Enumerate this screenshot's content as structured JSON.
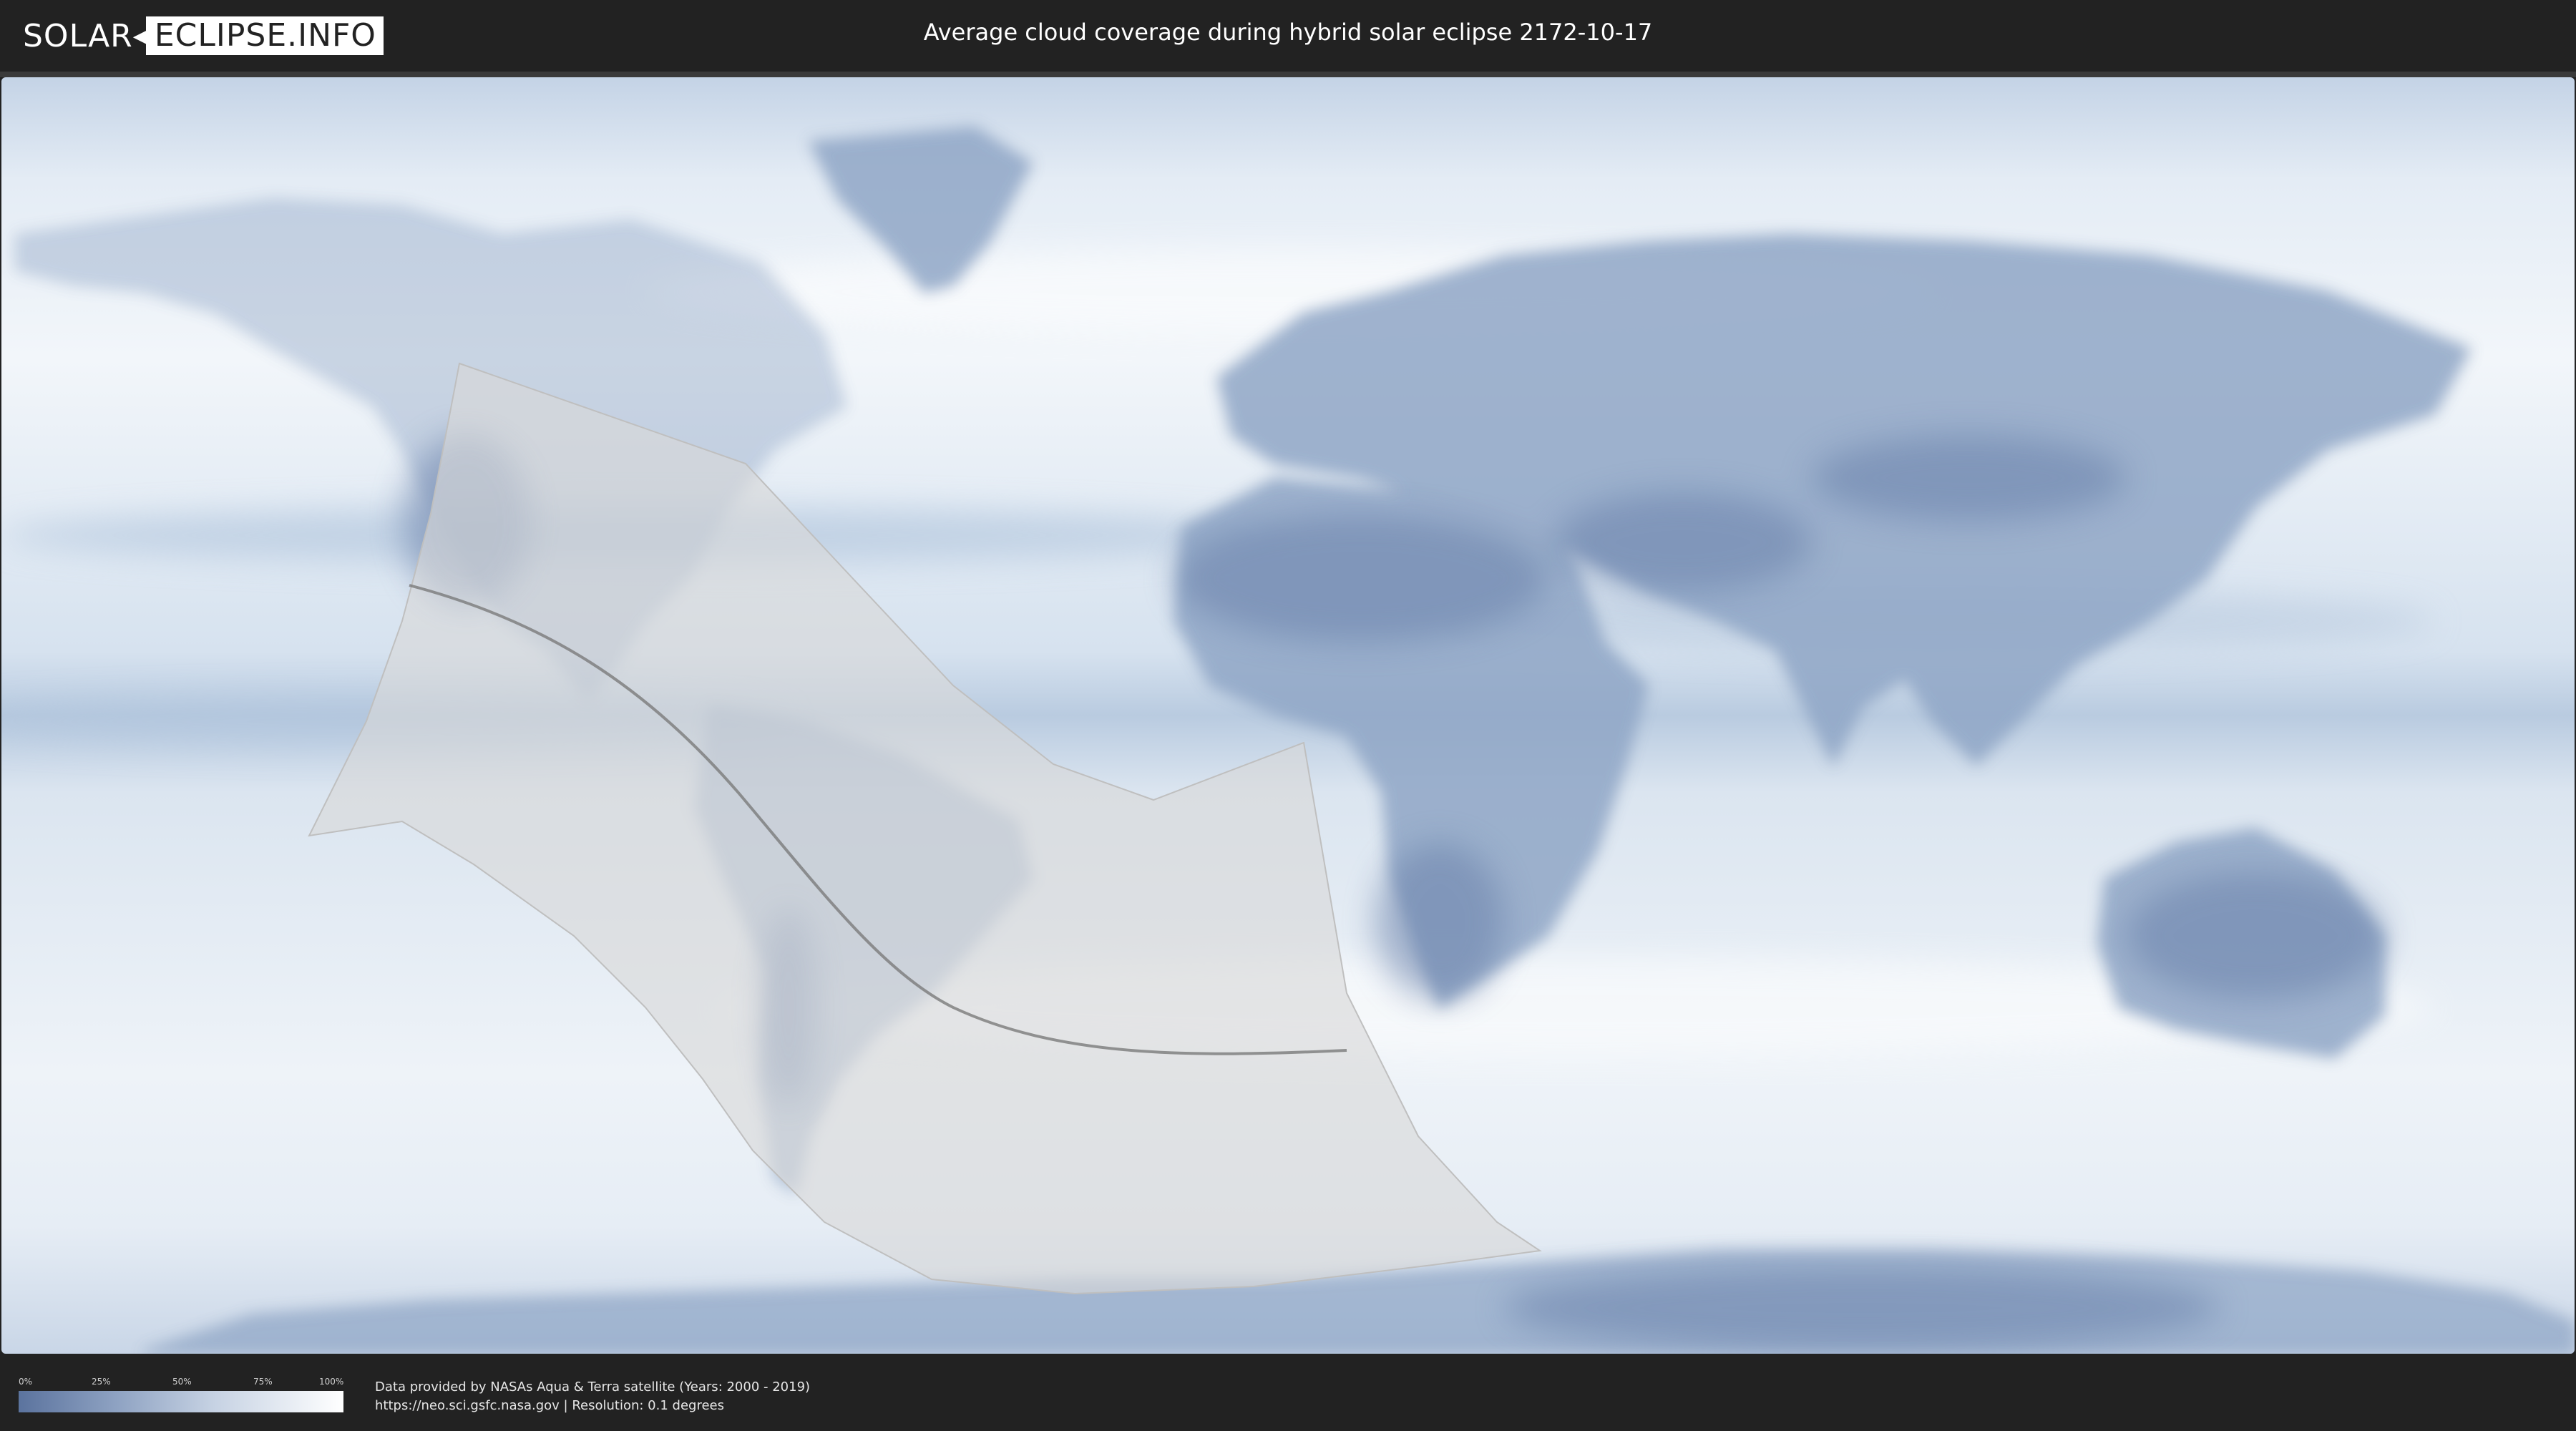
{
  "header": {
    "logo_left": "SOLAR",
    "logo_right": "ECLIPSE.INFO",
    "title": "Average cloud coverage during hybrid solar eclipse 2172-10-17"
  },
  "map": {
    "colors": {
      "clear_sky": "#5b739e",
      "cloudy": "#ffffff",
      "eclipse_overlay": "#d9d9d9",
      "central_line": "#7a7a7a"
    },
    "icons": {
      "logo": "eclipse-logo-icon"
    }
  },
  "legend": {
    "ticks": [
      "0%",
      "25%",
      "50%",
      "75%",
      "100%"
    ],
    "colors": [
      "#5b739e",
      "#ffffff"
    ]
  },
  "footer": {
    "credit_line_1": "Data provided by NASAs Aqua & Terra satellite (Years: 2000 - 2019)",
    "credit_line_2": "https://neo.sci.gsfc.nasa.gov | Resolution: 0.1 degrees"
  }
}
